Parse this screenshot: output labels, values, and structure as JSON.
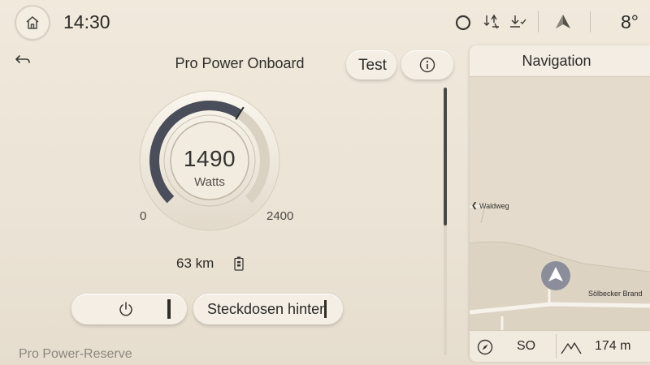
{
  "status": {
    "time": "14:30",
    "temperature": "8°"
  },
  "power": {
    "title": "Pro Power Onboard",
    "test_label": "Test",
    "gauge_value": "1490",
    "gauge_unit": "Watts",
    "scale_min": "0",
    "scale_max": "2400",
    "level_fraction": 0.62,
    "range": "63 km",
    "socket_label": "Steckdosen hinten",
    "reserve_label": "Pro Power-Reserve"
  },
  "navigation": {
    "title": "Navigation",
    "streets": [
      "Waldweg",
      "Sölbecker Brand"
    ],
    "heading": "SO",
    "altitude": "174 m"
  }
}
